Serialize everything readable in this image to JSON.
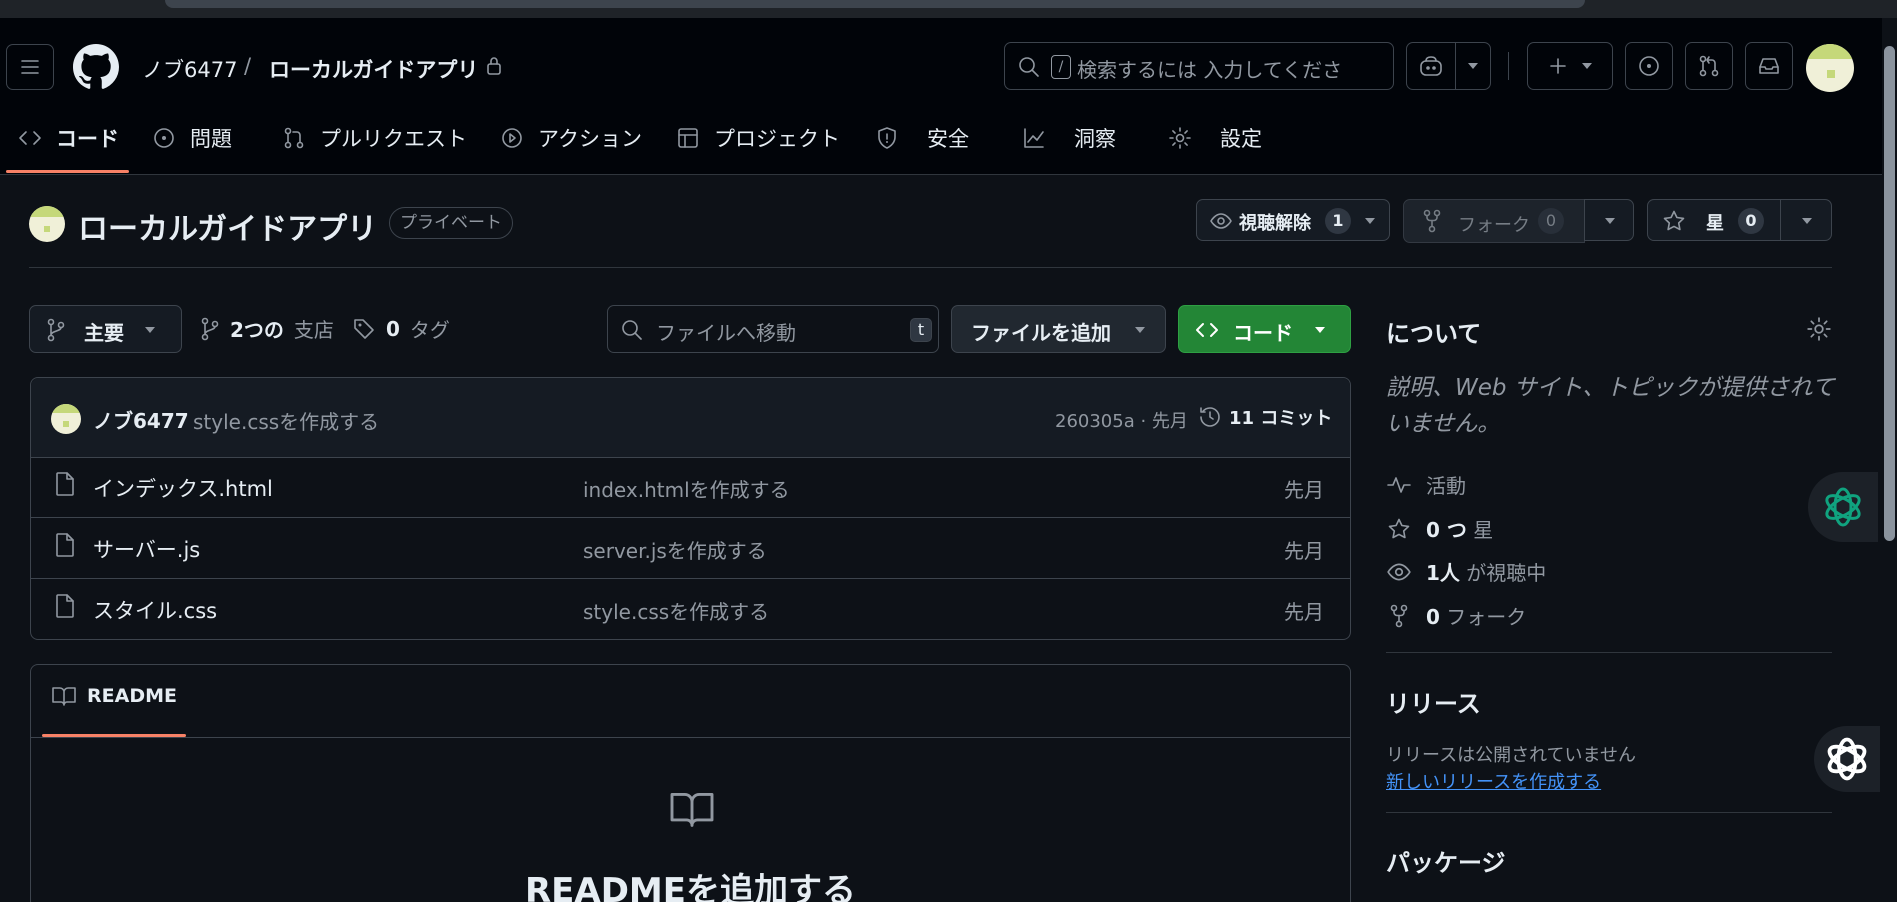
{
  "header": {
    "owner": "ノブ6477",
    "separator": "/",
    "repo": "ローカルガイドアプリ",
    "search_shortcut": "/",
    "search_placeholder": "検索するには 入力してくださ"
  },
  "tabs": [
    {
      "label": "コード",
      "icon": "code-icon"
    },
    {
      "label": "問題",
      "icon": "issue-icon"
    },
    {
      "label": "プルリクエスト",
      "icon": "pull-request-icon"
    },
    {
      "label": "アクション",
      "icon": "play-icon"
    },
    {
      "label": "プロジェクト",
      "icon": "table-icon"
    },
    {
      "label": "安全",
      "icon": "shield-icon"
    },
    {
      "label": "洞察",
      "icon": "graph-icon"
    },
    {
      "label": "設定",
      "icon": "gear-icon"
    }
  ],
  "repo_header": {
    "name": "ローカルガイドアプリ",
    "visibility": "プライベート",
    "watch_label": "視聴解除",
    "watch_count": "1",
    "fork_label": "フォーク",
    "fork_count": "0",
    "star_label": "星",
    "star_count": "0"
  },
  "toolbar": {
    "branch": "主要",
    "branches_count": "2つの",
    "branches_label": "支店",
    "tags_count": "0",
    "tags_label": "タグ",
    "goto_placeholder": "ファイルへ移動",
    "goto_shortcut": "t",
    "add_file": "ファイルを追加",
    "code_button": "コード"
  },
  "commit": {
    "author": "ノブ6477",
    "message": "style.cssを作成する",
    "hash_time": "260305a · 先月",
    "commits": "11 コミット"
  },
  "files": [
    {
      "name": "インデックス.html",
      "message": "index.htmlを作成する",
      "date": "先月"
    },
    {
      "name": "サーバー.js",
      "message": "server.jsを作成する",
      "date": "先月"
    },
    {
      "name": "スタイル.css",
      "message": "style.cssを作成する",
      "date": "先月"
    }
  ],
  "readme": {
    "tab": "README",
    "heading": "READMEを追加する"
  },
  "about": {
    "title": "について",
    "description": "説明、Web サイト、トピックが提供されていません。",
    "activity": "活動",
    "stars_count": "0 つ",
    "stars_label": "星",
    "watchers_count": "1人",
    "watchers_label": "が視聴中",
    "forks_count": "0",
    "forks_label": "フォーク"
  },
  "releases": {
    "title": "リリース",
    "none": "リリースは公開されていません",
    "create_link": "新しいリリースを作成する"
  },
  "packages": {
    "title": "パッケージ"
  },
  "colors": {
    "background": "#0d1117",
    "header_bg": "#010409",
    "accent_underline": "#f78166",
    "code_button": "#238636",
    "link": "#4493f8"
  }
}
